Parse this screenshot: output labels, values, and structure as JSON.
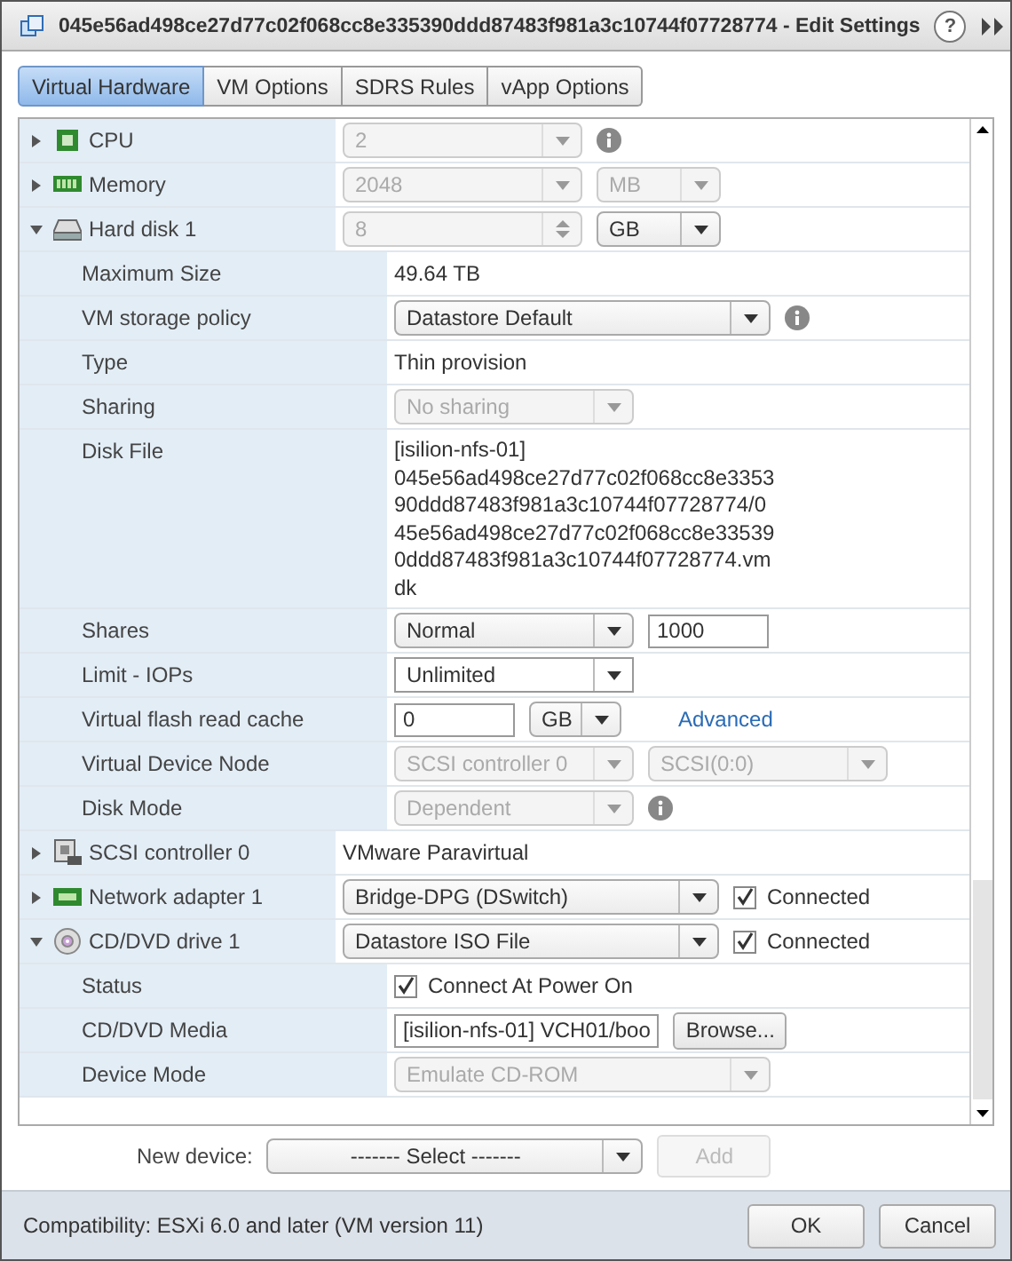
{
  "window": {
    "title": "045e56ad498ce27d77c02f068cc8e335390ddd87483f981a3c10744f07728774 - Edit Settings",
    "help": "?"
  },
  "tabs": [
    {
      "label": "Virtual Hardware",
      "selected": true
    },
    {
      "label": "VM Options",
      "selected": false
    },
    {
      "label": "SDRS Rules",
      "selected": false
    },
    {
      "label": "vApp Options",
      "selected": false
    }
  ],
  "rows": [
    {
      "kind": "cpu",
      "label": "CPU",
      "expanded": false,
      "controls": [
        {
          "kind": "dropdown",
          "value": "2",
          "disabled": true
        },
        {
          "kind": "info"
        }
      ]
    },
    {
      "kind": "memory",
      "label": "Memory",
      "expanded": false,
      "controls": [
        {
          "kind": "dropdown",
          "value": "2048",
          "disabled": true
        },
        {
          "kind": "unit-dropdown",
          "value": "MB",
          "disabled": true
        }
      ]
    },
    {
      "kind": "disk",
      "label": "Hard disk 1",
      "expanded": true,
      "controls": [
        {
          "kind": "spinner",
          "value": "8",
          "disabled": true
        },
        {
          "kind": "unit-dropdown",
          "value": "GB",
          "disabled": false
        }
      ]
    },
    {
      "kind": "property",
      "label": "Maximum Size",
      "controls": [
        {
          "kind": "text",
          "value": "49.64 TB"
        }
      ]
    },
    {
      "kind": "property",
      "label": "VM storage policy",
      "controls": [
        {
          "kind": "wide-dropdown",
          "value": "Datastore Default",
          "disabled": false
        },
        {
          "kind": "info"
        }
      ]
    },
    {
      "kind": "property",
      "label": "Type",
      "controls": [
        {
          "kind": "text",
          "value": "Thin provision"
        }
      ]
    },
    {
      "kind": "property",
      "label": "Sharing",
      "controls": [
        {
          "kind": "dropdown",
          "value": "No sharing",
          "disabled": true
        }
      ]
    },
    {
      "kind": "property",
      "label": "Disk File",
      "controls": [
        {
          "kind": "multiline",
          "lines": [
            "[isilion-nfs-01]",
            "045e56ad498ce27d77c02f068cc8e3353",
            "90ddd87483f981a3c10744f07728774/0",
            "45e56ad498ce27d77c02f068cc8e33539",
            "0ddd87483f981a3c10744f07728774.vm",
            "dk"
          ]
        }
      ]
    },
    {
      "kind": "property",
      "label": "Shares",
      "controls": [
        {
          "kind": "dropdown",
          "value": "Normal",
          "disabled": false
        },
        {
          "kind": "field",
          "value": "1000"
        }
      ]
    },
    {
      "kind": "property",
      "label": "Limit - IOPs",
      "controls": [
        {
          "kind": "combo",
          "value": "Unlimited"
        }
      ]
    },
    {
      "kind": "property",
      "label": "Virtual flash read cache",
      "controls": [
        {
          "kind": "field",
          "value": "0"
        },
        {
          "kind": "mini-dropdown",
          "value": "GB",
          "disabled": false
        },
        {
          "kind": "link",
          "value": "Advanced"
        }
      ]
    },
    {
      "kind": "property",
      "label": "Virtual Device Node",
      "controls": [
        {
          "kind": "dropdown",
          "value": "SCSI controller 0",
          "disabled": true
        },
        {
          "kind": "dropdown",
          "value": "SCSI(0:0)",
          "disabled": true
        }
      ]
    },
    {
      "kind": "property",
      "label": "Disk Mode",
      "controls": [
        {
          "kind": "dropdown",
          "value": "Dependent",
          "disabled": true
        },
        {
          "kind": "info"
        }
      ]
    },
    {
      "kind": "scsi",
      "label": "SCSI controller 0",
      "expanded": false,
      "controls": [
        {
          "kind": "text",
          "value": "VMware Paravirtual"
        }
      ]
    },
    {
      "kind": "network",
      "label": "Network adapter 1",
      "expanded": false,
      "controls": [
        {
          "kind": "wide-dropdown",
          "value": "Bridge-DPG (DSwitch)",
          "disabled": false
        },
        {
          "kind": "checkbox",
          "label": "Connected",
          "checked": true
        }
      ]
    },
    {
      "kind": "cdrom",
      "label": "CD/DVD drive 1",
      "expanded": true,
      "controls": [
        {
          "kind": "wide-dropdown",
          "value": "Datastore ISO File",
          "disabled": false
        },
        {
          "kind": "checkbox",
          "label": "Connected",
          "checked": true
        }
      ]
    },
    {
      "kind": "property",
      "label": "Status",
      "controls": [
        {
          "kind": "checkbox",
          "label": "Connect At Power On",
          "checked": true
        }
      ]
    },
    {
      "kind": "property",
      "label": "CD/DVD Media",
      "controls": [
        {
          "kind": "field",
          "value": "[isilion-nfs-01] VCH01/boo"
        },
        {
          "kind": "button",
          "value": "Browse..."
        }
      ]
    },
    {
      "kind": "property",
      "label": "Device Mode",
      "controls": [
        {
          "kind": "wide-dropdown",
          "value": "Emulate CD-ROM",
          "disabled": true
        }
      ]
    }
  ],
  "new_device": {
    "label": "New device:",
    "select": "------- Select -------",
    "add": {
      "label": "Add",
      "disabled": true
    }
  },
  "footer": {
    "compatibility": "Compatibility: ESXi 6.0 and later (VM version 11)",
    "buttons": [
      "OK",
      "Cancel"
    ]
  }
}
